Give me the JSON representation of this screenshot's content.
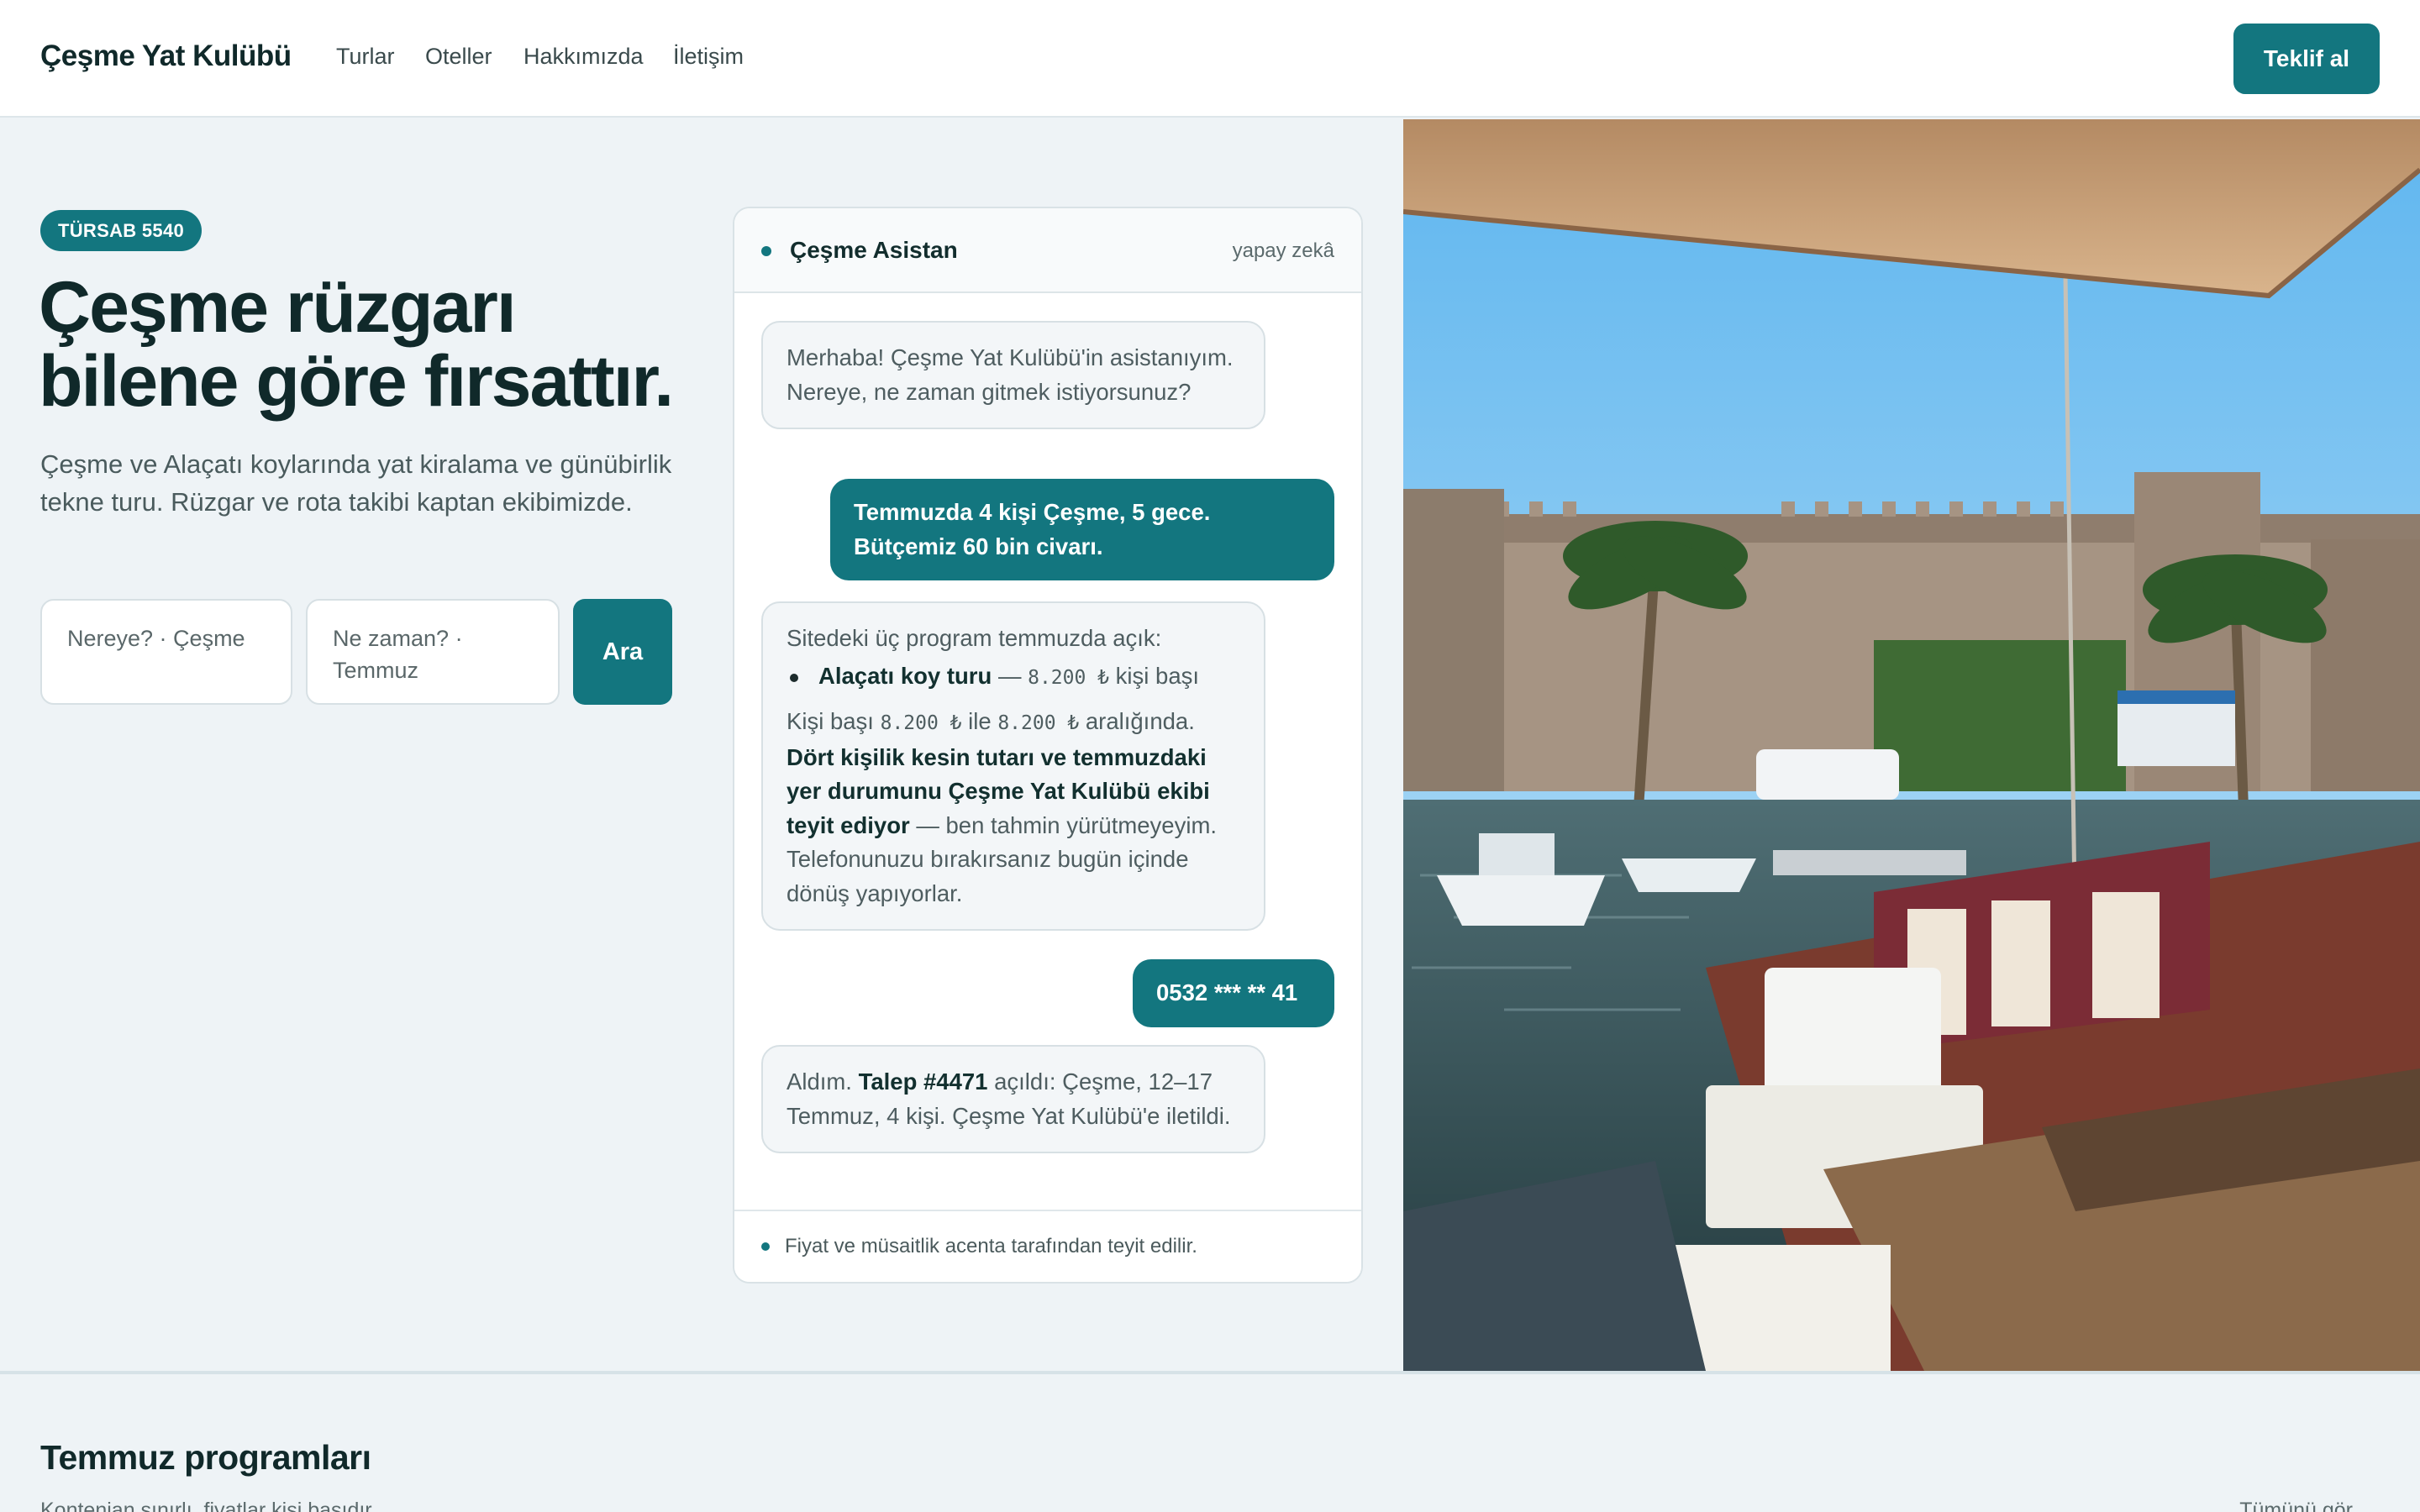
{
  "nav": {
    "brand": "Çeşme Yat Kulübü",
    "links": [
      "Turlar",
      "Oteller",
      "Hakkımızda",
      "İletişim"
    ],
    "cta": "Teklif al"
  },
  "hero": {
    "badge": "TÜRSAB 5540",
    "title_line1": "Çeşme rüzgarı",
    "title_line2": "bilene göre fırsattır.",
    "subtitle": "Çeşme ve Alaçatı koylarında yat kiralama ve günübirlik tekne turu. Rüzgar ve rota takibi kaptan ekibimizde.",
    "where_field": "Nereye? · Çeşme",
    "when_field": "Ne zaman? · Temmuz",
    "search_button": "Ara"
  },
  "chat": {
    "title": "Çeşme Asistan",
    "tag": "yapay zekâ",
    "msg1": "Merhaba! Çeşme Yat Kulübü'in asistanıyım. Nereye, ne zaman gitmek istiyorsunuz?",
    "msg2": "Temmuzda 4 kişi Çeşme, 5 gece. Bütçemiz 60 bin civarı.",
    "msg3": {
      "intro": "Sitedeki üç program temmuzda açık:",
      "item_name": "Alaçatı koy turu",
      "item_sep": "—",
      "item_price": "8.200 ₺",
      "item_unit": "kişi başı",
      "range_a": "Kişi başı",
      "range_low": "8.200 ₺",
      "range_b": "ile",
      "range_high": "8.200 ₺",
      "range_c": "aralığında.",
      "bold_part": "Dört kişilik kesin tutarı ve temmuzdaki yer durumunu Çeşme Yat Kulübü ekibi teyit ediyor",
      "rest": "— ben tahmin yürütmeyeyim. Telefonunuzu bırakırsanız bugün içinde dönüş yapıyorlar."
    },
    "msg4": "0532 *** ** 41",
    "msg5": {
      "a": "Aldım.",
      "ticket": "Talep #4471",
      "b": "açıldı: Çeşme, 12–17 Temmuz, 4 kişi. Çeşme Yat Kulübü'e iletildi."
    },
    "footer": "Fiyat ve müsaitlik acenta tarafından teyit edilir."
  },
  "section": {
    "title": "Temmuz programları",
    "subtitle": "Kontenjan sınırlı, fiyatlar kişi başıdır.",
    "see_all": "Tümünü gör"
  },
  "colors": {
    "accent": "#13767f",
    "background": "#eef3f6",
    "heading": "#10292a"
  }
}
